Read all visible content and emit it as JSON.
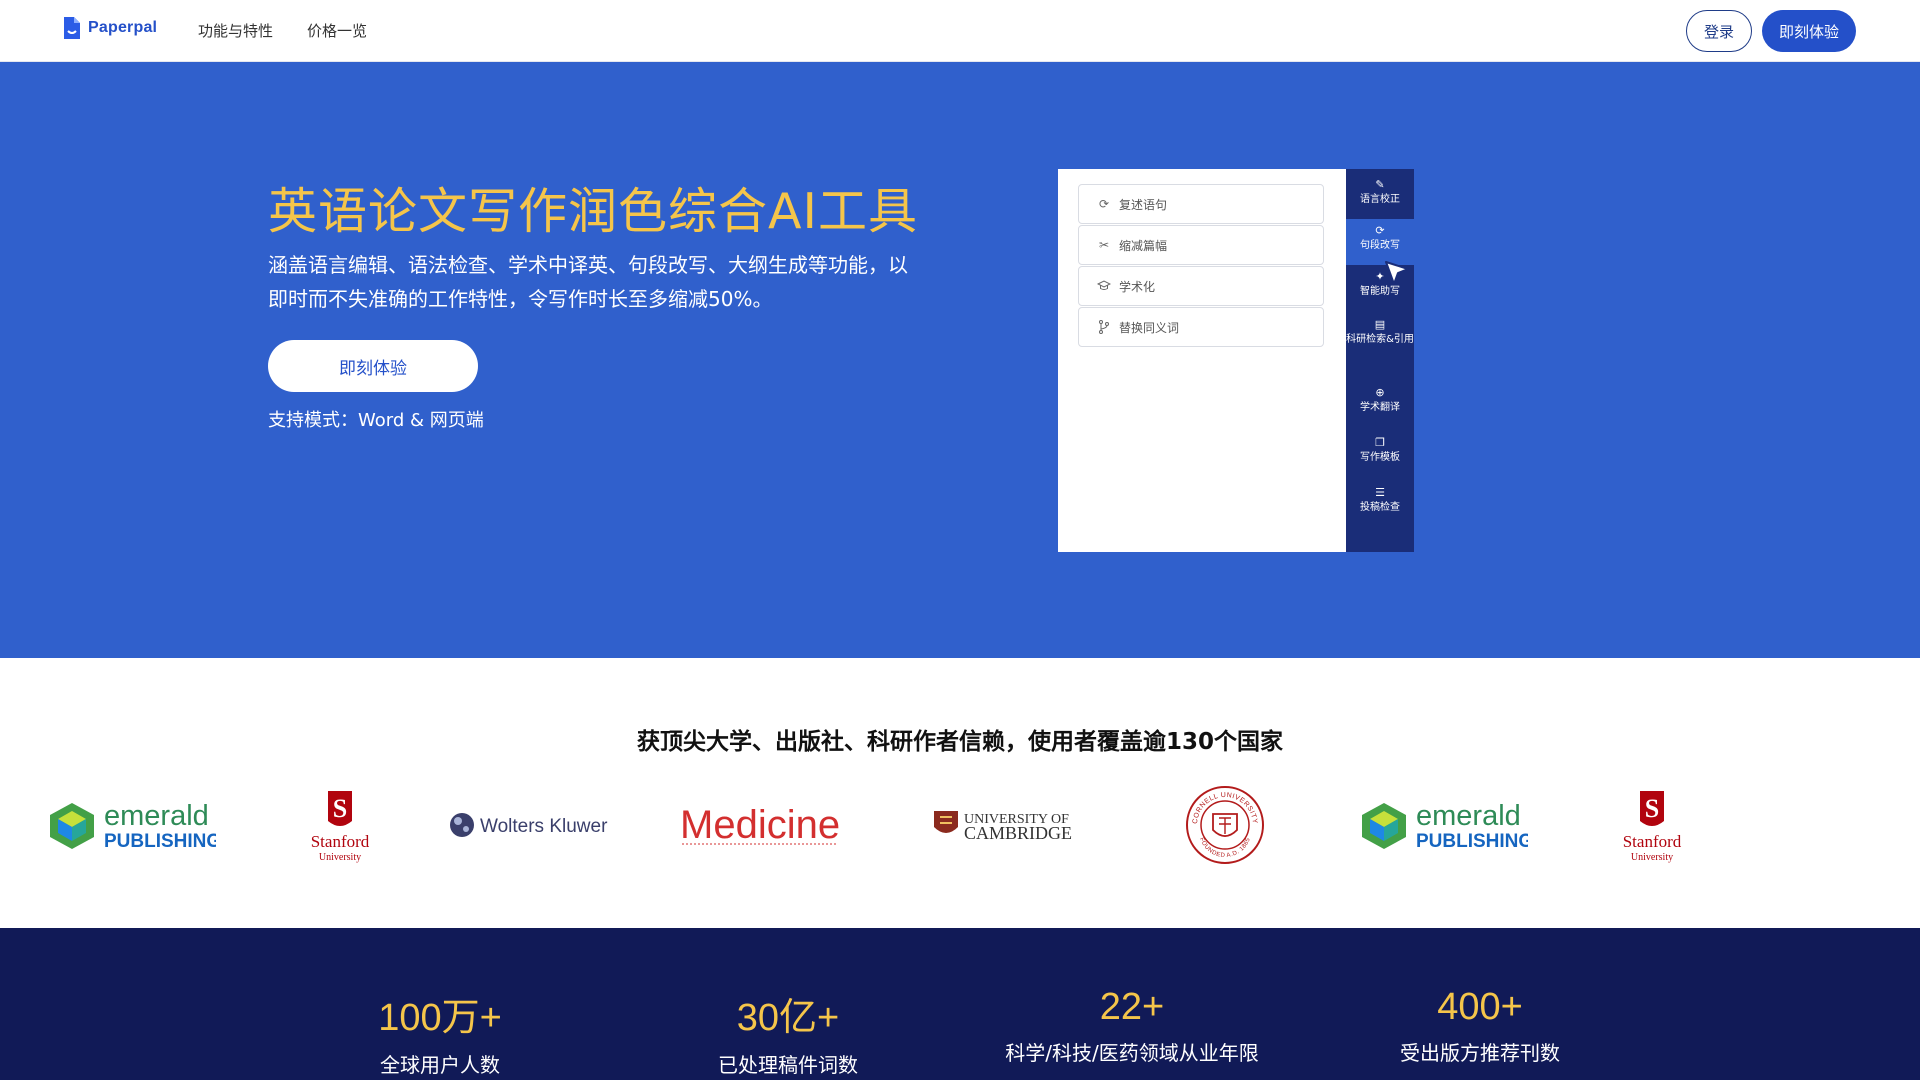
{
  "header": {
    "logo_text": "Paperpal",
    "nav": [
      {
        "label": "功能与特性"
      },
      {
        "label": "价格一览"
      }
    ],
    "login_label": "登录",
    "try_label": "即刻体验"
  },
  "hero": {
    "title": "英语论文写作润色综合AI工具",
    "description": "涵盖语言编辑、语法检查、学术中译英、句段改写、大纲生成等功能，以即时而不失准确的工作特性，令写作时长至多缩减50%。",
    "cta_label": "即刻体验",
    "support": "支持模式：Word & 网页端"
  },
  "mockup": {
    "options": [
      {
        "label": "复述语句",
        "icon": "refresh-icon"
      },
      {
        "label": "缩减篇幅",
        "icon": "scissors-icon"
      },
      {
        "label": "学术化",
        "icon": "graduation-cap-icon"
      },
      {
        "label": "替换同义词",
        "icon": "branch-icon"
      }
    ],
    "sidebar": [
      {
        "label": "语言校正",
        "icon": "pen-icon"
      },
      {
        "label": "句段改写",
        "icon": "refresh-icon"
      },
      {
        "label": "智能助写",
        "icon": "sparkle-icon"
      },
      {
        "label": "科研检索&引用",
        "icon": "books-icon"
      },
      {
        "label": "学术翻译",
        "icon": "globe-icon"
      },
      {
        "label": "写作模板",
        "icon": "copy-icon"
      },
      {
        "label": "投稿检查",
        "icon": "checklist-icon"
      }
    ],
    "active_index": 1
  },
  "trust": {
    "title": "获顶尖大学、出版社、科研作者信赖，使用者覆盖逾130个国家",
    "brands": [
      {
        "line1": "emerald",
        "line2": "PUBLISHING"
      },
      {
        "line1": "Stanford",
        "line2": "University"
      },
      {
        "line1": "Wolters Kluwer"
      },
      {
        "line1": "Medicine"
      },
      {
        "line1": "UNIVERSITY OF",
        "line2": "CAMBRIDGE"
      },
      {
        "line1": "CORNELL UNIVERSITY",
        "line2": "FOUNDED A.D. 1865"
      },
      {
        "line1": "emerald",
        "line2": "PUBLISHING"
      },
      {
        "line1": "Stanford",
        "line2": "University"
      }
    ]
  },
  "stats": [
    {
      "value": "100万+",
      "label": "全球用户人数"
    },
    {
      "value": "30亿+",
      "label": "已处理稿件词数"
    },
    {
      "value": "22+",
      "label": "科学/科技/医药领域从业年限"
    },
    {
      "value": "400+",
      "label": "受出版方推荐刊数"
    }
  ],
  "colors": {
    "brand_blue": "#2450c9",
    "hero_bg": "#3060cc",
    "accent_gold": "#f5c54a",
    "stats_bg": "#111a57"
  }
}
